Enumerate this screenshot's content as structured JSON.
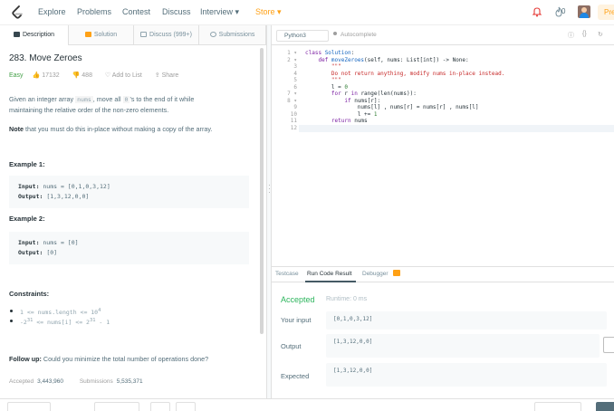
{
  "nav": {
    "items": [
      "Explore",
      "Problems",
      "Contest",
      "Discuss",
      "Interview ▾",
      "Store ▾"
    ],
    "streak_count": "0",
    "premium_label": "Pre"
  },
  "left_tabs": [
    "Description",
    "Solution",
    "Discuss (999+)",
    "Submissions"
  ],
  "problem": {
    "title": "283. Move Zeroes",
    "difficulty": "Easy",
    "likes": "17132",
    "dislikes": "488",
    "add_to_list": "Add to List",
    "share": "Share",
    "desc_1a": "Given an integer array",
    "desc_nums": "nums",
    "desc_1b": ", move all",
    "desc_zero": "0",
    "desc_1c": "'s to the end of it while",
    "desc_2": "maintaining the relative order of the non-zero elements.",
    "note_bold": "Note",
    "note_rest": " that you must do this in-place without making a copy of the array.",
    "example1_title": "Example 1:",
    "example1_input_label": "Input:",
    "example1_input": " nums = [0,1,0,3,12]",
    "example1_output_label": "Output:",
    "example1_output": " [1,3,12,0,0]",
    "example2_title": "Example 2:",
    "example2_input_label": "Input:",
    "example2_input": " nums = [0]",
    "example2_output_label": "Output:",
    "example2_output": " [0]",
    "constraints_title": "Constraints:",
    "constraint_1": "1 <= nums.length <= 10",
    "constraint_1_sup": "4",
    "constraint_2a": "-2",
    "constraint_2a_sup": "31",
    "constraint_2b": " <= nums[i] <= 2",
    "constraint_2b_sup": "31",
    "constraint_2c": " - 1",
    "followup_bold": "Follow up:",
    "followup_rest": " Could you minimize the total number of operations done?",
    "accepted_label": "Accepted",
    "accepted_value": "3,443,960",
    "submissions_label": "Submissions",
    "submissions_value": "5,535,371"
  },
  "editor": {
    "language": "Python3",
    "autocomplete": "Autocomplete",
    "line_numbers": [
      "1 ▾",
      "2 ▾",
      "3",
      "4",
      "5",
      "6",
      "7 ▾",
      "8 ▾",
      "9",
      "10",
      "11",
      "12"
    ]
  },
  "console": {
    "tabs": [
      "Testcase",
      "Run Code Result",
      "Debugger"
    ],
    "status": "Accepted",
    "runtime": "Runtime: 0 ms",
    "input_label": "Your input",
    "input_value": "[0,1,0,3,12]",
    "output_label": "Output",
    "output_value": "[1,3,12,0,0]",
    "expected_label": "Expected",
    "expected_value": "[1,3,12,0,0]"
  },
  "colors": {
    "accent": "#ffa116",
    "accepted": "#2db55d",
    "easy": "#43a047"
  }
}
